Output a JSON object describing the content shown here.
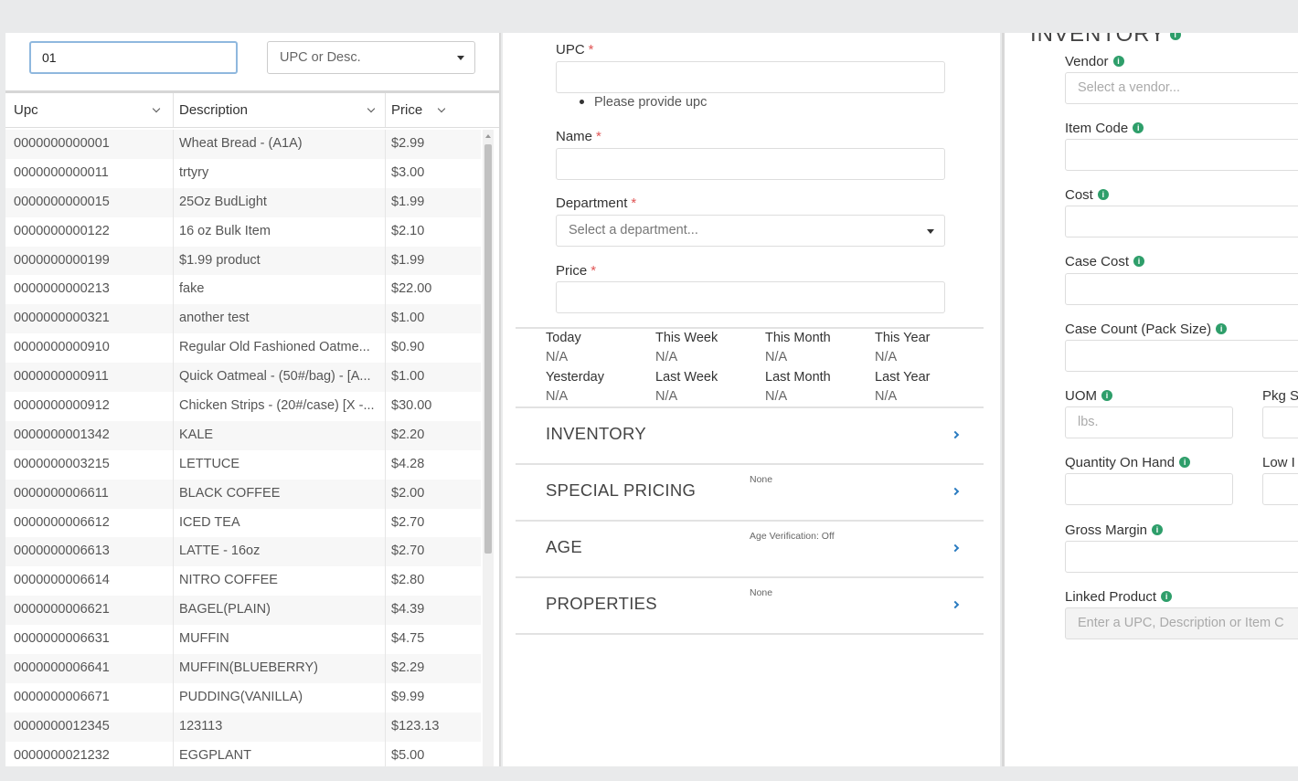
{
  "search": {
    "value": "01",
    "type_label": "UPC or Desc."
  },
  "grid": {
    "headers": {
      "upc": "Upc",
      "description": "Description",
      "price": "Price"
    },
    "rows": [
      {
        "upc": "0000000000001",
        "description": "Wheat Bread - (A1A)",
        "price": "$2.99"
      },
      {
        "upc": "0000000000011",
        "description": "trtyry",
        "price": "$3.00"
      },
      {
        "upc": "0000000000015",
        "description": "25Oz BudLight",
        "price": "$1.99"
      },
      {
        "upc": "0000000000122",
        "description": "16 oz Bulk Item",
        "price": "$2.10"
      },
      {
        "upc": "0000000000199",
        "description": "$1.99 product",
        "price": "$1.99"
      },
      {
        "upc": "0000000000213",
        "description": "fake",
        "price": "$22.00"
      },
      {
        "upc": "0000000000321",
        "description": "another test",
        "price": "$1.00"
      },
      {
        "upc": "0000000000910",
        "description": "Regular Old Fashioned Oatme...",
        "price": "$0.90"
      },
      {
        "upc": "0000000000911",
        "description": "Quick Oatmeal - (50#/bag) - [A...",
        "price": "$1.00"
      },
      {
        "upc": "0000000000912",
        "description": "Chicken Strips - (20#/case) [X -...",
        "price": "$30.00"
      },
      {
        "upc": "0000000001342",
        "description": "KALE",
        "price": "$2.20"
      },
      {
        "upc": "0000000003215",
        "description": "LETTUCE",
        "price": "$4.28"
      },
      {
        "upc": "0000000006611",
        "description": "BLACK COFFEE",
        "price": "$2.00"
      },
      {
        "upc": "0000000006612",
        "description": "ICED TEA",
        "price": "$2.70"
      },
      {
        "upc": "0000000006613",
        "description": "LATTE - 16oz",
        "price": "$2.70"
      },
      {
        "upc": "0000000006614",
        "description": "NITRO COFFEE",
        "price": "$2.80"
      },
      {
        "upc": "0000000006621",
        "description": "BAGEL(PLAIN)",
        "price": "$4.39"
      },
      {
        "upc": "0000000006631",
        "description": "MUFFIN",
        "price": "$4.75"
      },
      {
        "upc": "0000000006641",
        "description": "MUFFIN(BLUEBERRY)",
        "price": "$2.29"
      },
      {
        "upc": "0000000006671",
        "description": "PUDDING(VANILLA)",
        "price": "$9.99"
      },
      {
        "upc": "0000000012345",
        "description": "123113",
        "price": "$123.13"
      },
      {
        "upc": "0000000021232",
        "description": "EGGPLANT",
        "price": "$5.00"
      }
    ]
  },
  "form": {
    "upc_label": "UPC",
    "upc_error": "Please provide upc",
    "name_label": "Name",
    "department_label": "Department",
    "department_placeholder": "Select a department...",
    "price_label": "Price",
    "required_mark": "*"
  },
  "stats": [
    {
      "label": "Today",
      "value": "N/A"
    },
    {
      "label": "This Week",
      "value": "N/A"
    },
    {
      "label": "This Month",
      "value": "N/A"
    },
    {
      "label": "This Year",
      "value": "N/A"
    },
    {
      "label": "Yesterday",
      "value": "N/A"
    },
    {
      "label": "Last Week",
      "value": "N/A"
    },
    {
      "label": "Last Month",
      "value": "N/A"
    },
    {
      "label": "Last Year",
      "value": "N/A"
    }
  ],
  "sections": [
    {
      "title": "INVENTORY",
      "note": ""
    },
    {
      "title": "SPECIAL PRICING",
      "note": "None"
    },
    {
      "title": "AGE",
      "note": "Age Verification: Off"
    },
    {
      "title": "PROPERTIES",
      "note": "None"
    }
  ],
  "inventory": {
    "heading": "INVENTORY",
    "vendor_label": "Vendor",
    "vendor_placeholder": "Select a vendor...",
    "item_code_label": "Item Code",
    "cost_label": "Cost",
    "case_cost_label": "Case Cost",
    "case_count_label": "Case Count (Pack Size)",
    "uom_label": "UOM",
    "uom_placeholder": "lbs.",
    "pkg_label": "Pkg S",
    "qoh_label": "Quantity On Hand",
    "low_label": "Low I",
    "gross_margin_label": "Gross Margin",
    "linked_product_label": "Linked Product",
    "linked_product_placeholder": "Enter a UPC, Description or Item C",
    "info_glyph": "i"
  },
  "colors": {
    "accent": "#2a7bc0",
    "info": "#2e9e6a",
    "required": "#e05555"
  }
}
